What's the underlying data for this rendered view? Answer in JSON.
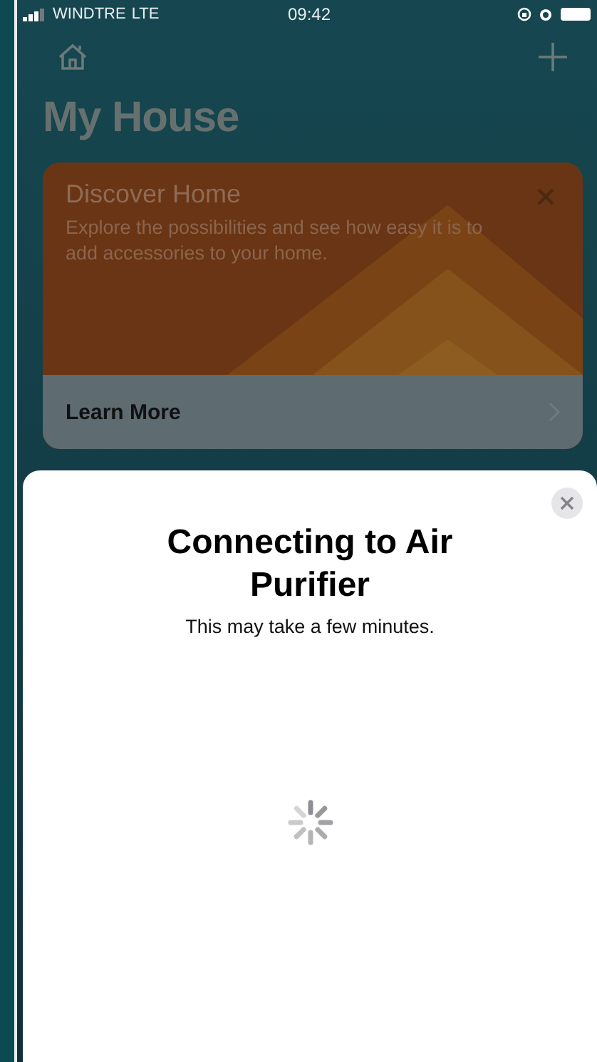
{
  "status_bar": {
    "carrier": "WINDTRE",
    "network": "LTE",
    "time": "09:42"
  },
  "home": {
    "title": "My House"
  },
  "discover_card": {
    "title": "Discover Home",
    "text": "Explore the possibilities and see how easy it is to add accessories to your home.",
    "link": "Learn More"
  },
  "sheet": {
    "title": "Connecting to Air Purifier",
    "subtitle": "This may take a few minutes."
  }
}
